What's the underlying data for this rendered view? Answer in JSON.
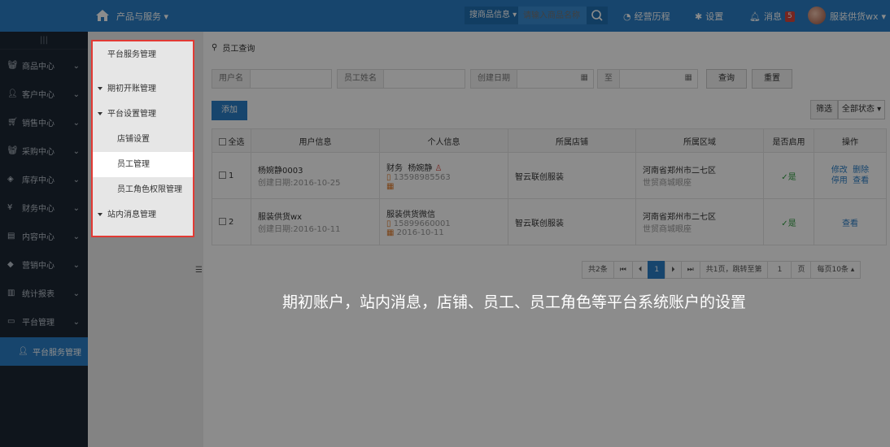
{
  "topbar": {
    "product_menu": "产品与服务",
    "search_category": "搜商品信息",
    "search_placeholder": "请输入商品名称",
    "history": "经营历程",
    "settings": "设置",
    "messages": "消息",
    "message_count": "5",
    "user": "服装供货wx"
  },
  "sidebar": {
    "toggle": "|||",
    "items": [
      {
        "label": "商品中心"
      },
      {
        "label": "客户中心"
      },
      {
        "label": "销售中心"
      },
      {
        "label": "采购中心"
      },
      {
        "label": "库存中心"
      },
      {
        "label": "财务中心"
      },
      {
        "label": "内容中心"
      },
      {
        "label": "营销中心"
      },
      {
        "label": "统计报表"
      },
      {
        "label": "平台管理"
      }
    ],
    "active": "平台服务管理"
  },
  "submenu": {
    "title": "平台服务管理",
    "items": [
      {
        "label": "期初开账管理"
      },
      {
        "label": "平台设置管理"
      },
      {
        "label": "店铺设置"
      },
      {
        "label": "员工管理"
      },
      {
        "label": "员工角色权限管理"
      },
      {
        "label": "站内消息管理"
      }
    ]
  },
  "main": {
    "breadcrumb": "员工查询",
    "filters": {
      "username_label": "用户名",
      "staff_name_label": "员工姓名",
      "created_label": "创建日期",
      "to_label": "至",
      "query_button": "查询",
      "reset_button": "重置"
    },
    "add_button": "添加",
    "filter_button": "筛选",
    "status_select": "全部状态",
    "table": {
      "headers": [
        "全选",
        "用户信息",
        "个人信息",
        "所属店铺",
        "所属区域",
        "是否启用",
        "操作"
      ],
      "rows": [
        {
          "index": "1",
          "user": "杨婉静0003",
          "created": "创建日期:2016-10-25",
          "role": "财务",
          "person": "杨婉静",
          "phone": "13598985563",
          "shop": "智云联创服装",
          "region": "河南省郑州市二七区",
          "mall": "世贸商城眼座",
          "enabled": "是",
          "actions": [
            "修改",
            "删除",
            "停用",
            "查看"
          ]
        },
        {
          "index": "2",
          "user": "服装供货wx",
          "created": "创建日期:2016-10-11",
          "role": "服装供货微信",
          "person": "",
          "phone": "15899660001",
          "date": "2016-10-11",
          "shop": "智云联创服装",
          "region": "河南省郑州市二七区",
          "mall": "世贸商城眼座",
          "enabled": "是",
          "actions": [
            "查看"
          ]
        }
      ]
    },
    "pager": {
      "total": "共2条",
      "first": "⏮",
      "prev": "⏴",
      "current": "1",
      "next": "⏵",
      "last": "⏭",
      "pages": "共1页，跳转至第",
      "jump_value": "1",
      "page_unit": "页",
      "per_page": "每页10条"
    }
  },
  "caption": "期初账户，站内消息，店铺、员工、员工角色等平台系统账户的设置"
}
